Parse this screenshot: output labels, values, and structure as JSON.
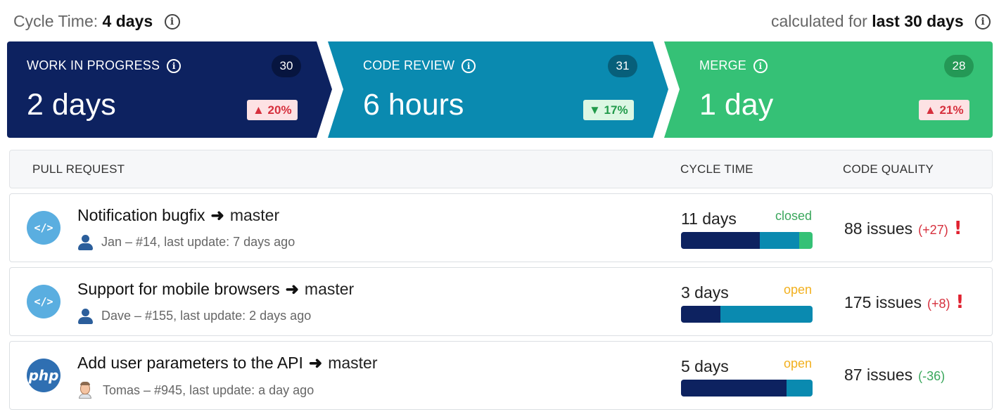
{
  "summary": {
    "label": "Cycle Time:",
    "value": "4 days",
    "calculated_prefix": "calculated for",
    "calculated_period": "last 30 days"
  },
  "stages": [
    {
      "label": "WORK IN PROGRESS",
      "count": "30",
      "value": "2 days",
      "delta": "▲ 20%",
      "trend": "up",
      "color": "#0d2260"
    },
    {
      "label": "CODE REVIEW",
      "count": "31",
      "value": "6 hours",
      "delta": "▼ 17%",
      "trend": "down",
      "color": "#0a8ab0"
    },
    {
      "label": "MERGE",
      "count": "28",
      "value": "1 day",
      "delta": "▲ 21%",
      "trend": "up",
      "color": "#35c176"
    }
  ],
  "table": {
    "headers": {
      "pull_request": "PULL REQUEST",
      "cycle_time": "CYCLE TIME",
      "code_quality": "CODE QUALITY"
    },
    "rows": [
      {
        "icon": "code-icon",
        "icon_text": "</>",
        "title": "Notification bugfix",
        "arrow": "➜",
        "branch": "master",
        "avatar": "user-icon",
        "meta": "Jan – #14, last update: 7 days ago",
        "cycle_time": "11 days",
        "status": "closed",
        "bar": {
          "wip": 0.6,
          "review": 0.3,
          "merge": 0.1
        },
        "issues": "88 issues",
        "issues_delta": "(+27)",
        "warning": "!"
      },
      {
        "icon": "code-icon",
        "icon_text": "</>",
        "title": "Support for mobile browsers",
        "arrow": "➜",
        "branch": "master",
        "avatar": "user-icon",
        "meta": "Dave – #155, last update: 2 days ago",
        "cycle_time": "3 days",
        "status": "open",
        "bar": {
          "wip": 0.3,
          "review": 0.7,
          "merge": 0
        },
        "issues": "175 issues",
        "issues_delta": "(+8)",
        "warning": "!"
      },
      {
        "icon": "php-icon",
        "icon_text": "php",
        "title": "Add user parameters to the API",
        "arrow": "➜",
        "branch": "master",
        "avatar": "avatar-photo",
        "meta": "Tomas – #945, last update: a day ago",
        "cycle_time": "5 days",
        "status": "open",
        "bar": {
          "wip": 0.8,
          "review": 0.2,
          "merge": 0
        },
        "issues": "87 issues",
        "issues_delta": "(-36)",
        "warning": ""
      }
    ]
  }
}
